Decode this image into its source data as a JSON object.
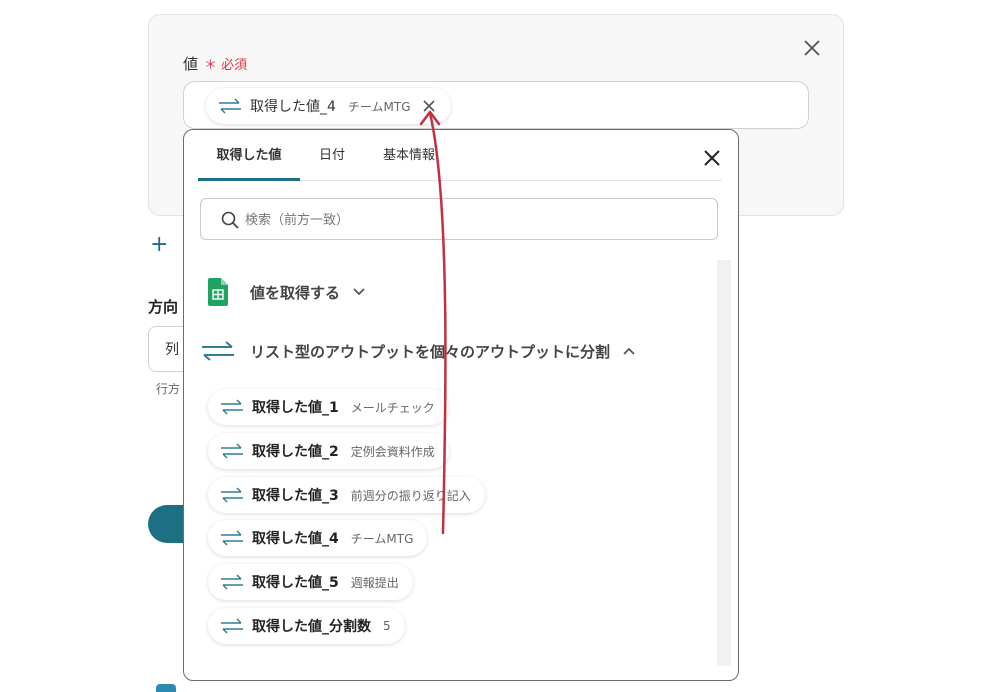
{
  "form": {
    "field_label": "値",
    "required_mark": "＊",
    "required_label": "必須",
    "selected_chip": {
      "title": "取得した値_4",
      "sub": "チームMTG"
    },
    "add_symbol": "+",
    "direction_label": "方向",
    "direction_value": "列",
    "direction_help": "行方"
  },
  "dropdown": {
    "tabs": [
      {
        "label": "取得した値",
        "active": true
      },
      {
        "label": "日付",
        "active": false
      },
      {
        "label": "基本情報",
        "active": false
      }
    ],
    "search": {
      "placeholder": "検索（前方一致）",
      "value": ""
    },
    "sections": [
      {
        "label": "値を取得する",
        "icon": "google-sheets-icon",
        "expanded": false
      },
      {
        "label": "リスト型のアウトプットを個々のアウトプットに分割",
        "icon": "swap-arrows-icon",
        "expanded": true
      }
    ],
    "items": [
      {
        "title": "取得した値_1",
        "sub": "メールチェック"
      },
      {
        "title": "取得した値_2",
        "sub": "定例会資料作成"
      },
      {
        "title": "取得した値_3",
        "sub": "前週分の振り返り記入"
      },
      {
        "title": "取得した値_4",
        "sub": "チームMTG"
      },
      {
        "title": "取得した値_5",
        "sub": "週報提出"
      },
      {
        "title": "取得した値_分割数",
        "sub": "5"
      }
    ]
  },
  "colors": {
    "accent": "#1d6f84",
    "required": "#e0364c",
    "annotation_arrow": "#c0303f",
    "sheets_green": "#1ea362"
  }
}
